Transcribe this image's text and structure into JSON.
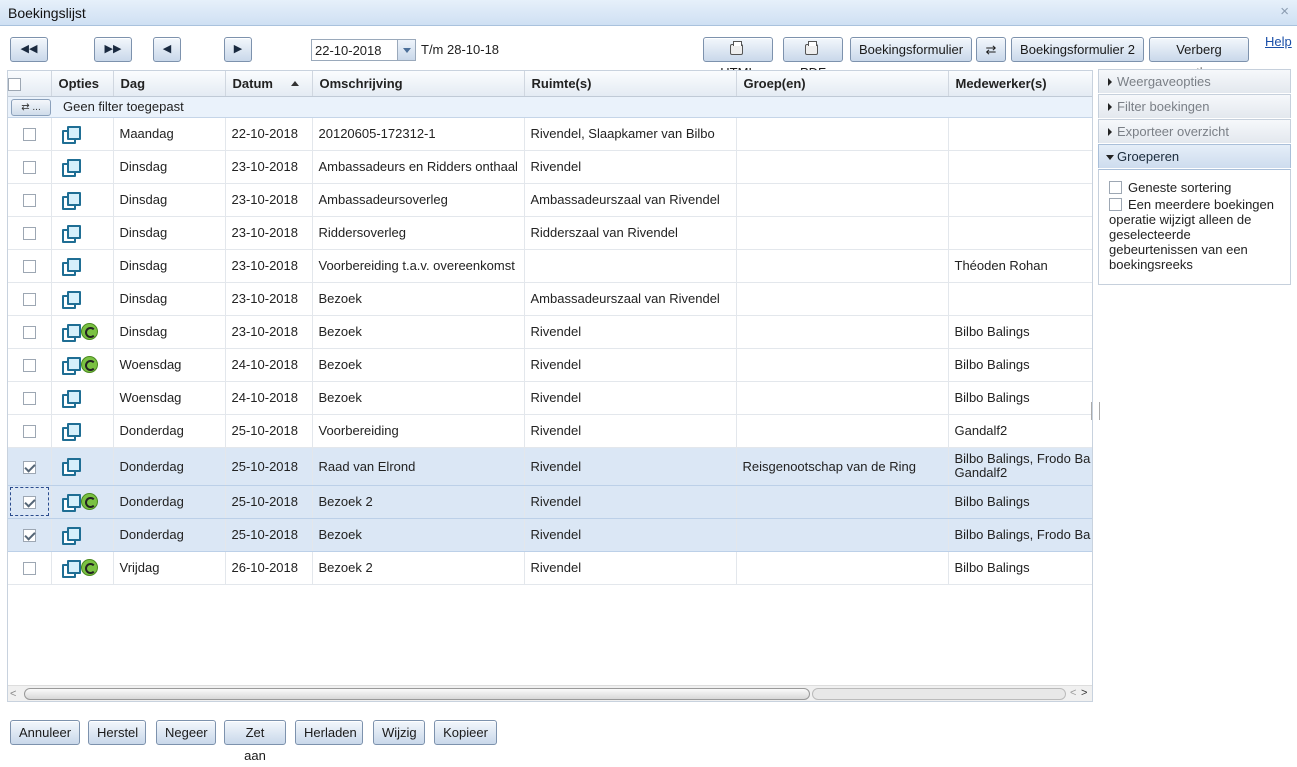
{
  "window": {
    "title": "Boekingslijst",
    "close": "×"
  },
  "toolbar": {
    "nav_first": "◀◀",
    "nav_last": "▶▶",
    "nav_prev": "◀",
    "nav_next": "▶",
    "date_value": "22-10-2018",
    "date_range": "T/m 28-10-18",
    "html": "HTML",
    "pdf": "PDF",
    "booking_form": "Boekingsformulier",
    "swap": "⇄",
    "booking_form_2": "Boekingsformulier 2",
    "hide_options": "Verberg opties",
    "help": "Help"
  },
  "grid": {
    "headers": {
      "opties": "Opties",
      "dag": "Dag",
      "datum": "Datum",
      "omschrijving": "Omschrijving",
      "ruimtes": "Ruimte(s)",
      "groepen": "Groep(en)",
      "medewerkers": "Medewerker(s)"
    },
    "filter_button": "⇄ ...",
    "filter_text": "Geen filter toegepast",
    "rows": [
      {
        "dag": "Maandag",
        "datum": "22-10-2018",
        "omschrijving": "20120605-172312-1",
        "ruimtes": "Rivendel, Slaapkamer van Bilbo",
        "groepen": "",
        "medewerkers": "",
        "medewerkers2": ""
      },
      {
        "dag": "Dinsdag",
        "datum": "23-10-2018",
        "omschrijving": "Ambassadeurs en Ridders onthaal",
        "ruimtes": "Rivendel",
        "groepen": "",
        "medewerkers": "",
        "medewerkers2": ""
      },
      {
        "dag": "Dinsdag",
        "datum": "23-10-2018",
        "omschrijving": "Ambassadeursoverleg",
        "ruimtes": "Ambassadeurszaal van Rivendel",
        "groepen": "",
        "medewerkers": "",
        "medewerkers2": ""
      },
      {
        "dag": "Dinsdag",
        "datum": "23-10-2018",
        "omschrijving": "Riddersoverleg",
        "ruimtes": "Ridderszaal van Rivendel",
        "groepen": "",
        "medewerkers": "",
        "medewerkers2": ""
      },
      {
        "dag": "Dinsdag",
        "datum": "23-10-2018",
        "omschrijving": "Voorbereiding t.a.v. overeenkomst",
        "ruimtes": "",
        "groepen": "",
        "medewerkers": "Théoden Rohan",
        "medewerkers2": ""
      },
      {
        "dag": "Dinsdag",
        "datum": "23-10-2018",
        "omschrijving": "Bezoek",
        "ruimtes": "Ambassadeurszaal van Rivendel",
        "groepen": "",
        "medewerkers": "",
        "medewerkers2": ""
      },
      {
        "dag": "Dinsdag",
        "datum": "23-10-2018",
        "omschrijving": "Bezoek",
        "ruimtes": "Rivendel",
        "groepen": "",
        "medewerkers": "Bilbo Balings",
        "medewerkers2": ""
      },
      {
        "dag": "Woensdag",
        "datum": "24-10-2018",
        "omschrijving": "Bezoek",
        "ruimtes": "Rivendel",
        "groepen": "",
        "medewerkers": "Bilbo Balings",
        "medewerkers2": ""
      },
      {
        "dag": "Woensdag",
        "datum": "24-10-2018",
        "omschrijving": "Bezoek",
        "ruimtes": "Rivendel",
        "groepen": "",
        "medewerkers": "Bilbo Balings",
        "medewerkers2": ""
      },
      {
        "dag": "Donderdag",
        "datum": "25-10-2018",
        "omschrijving": "Voorbereiding",
        "ruimtes": "Rivendel",
        "groepen": "",
        "medewerkers": "Gandalf2",
        "medewerkers2": ""
      },
      {
        "dag": "Donderdag",
        "datum": "25-10-2018",
        "omschrijving": "Raad van Elrond",
        "ruimtes": "Rivendel",
        "groepen": "Reisgenootschap van de Ring",
        "medewerkers": "Bilbo Balings, Frodo Ba",
        "medewerkers2": "Gandalf2"
      },
      {
        "dag": "Donderdag",
        "datum": "25-10-2018",
        "omschrijving": "Bezoek 2",
        "ruimtes": "Rivendel",
        "groepen": "",
        "medewerkers": "Bilbo Balings",
        "medewerkers2": ""
      },
      {
        "dag": "Donderdag",
        "datum": "25-10-2018",
        "omschrijving": "Bezoek",
        "ruimtes": "Rivendel",
        "groepen": "",
        "medewerkers": "Bilbo Balings, Frodo Ba",
        "medewerkers2": ""
      },
      {
        "dag": "Vrijdag",
        "datum": "26-10-2018",
        "omschrijving": "Bezoek 2",
        "ruimtes": "Rivendel",
        "groepen": "",
        "medewerkers": "Bilbo Balings",
        "medewerkers2": ""
      }
    ],
    "scroll_left": "<",
    "scroll_right_1": "<",
    "scroll_right_2": ">"
  },
  "side": {
    "weergave": "Weergaveopties",
    "filter": "Filter boekingen",
    "export": "Exporteer overzicht",
    "groeperen": "Groeperen",
    "opt_sorting": "Geneste sortering",
    "opt_series": "Een meerdere boekingen operatie wijzigt alleen de geselecteerde gebeurtenissen van een boekingsreeks"
  },
  "bottom": {
    "annuleer": "Annuleer",
    "herstel": "Herstel",
    "negeer": "Negeer",
    "zet_aan": "Zet aan",
    "herladen": "Herladen",
    "wijzig": "Wijzig",
    "kopieer": "Kopieer"
  }
}
